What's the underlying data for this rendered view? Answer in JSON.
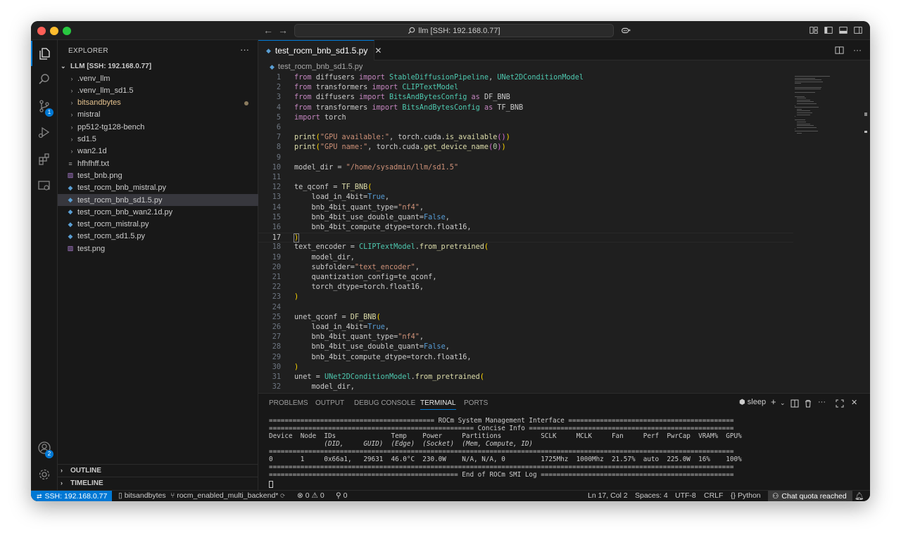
{
  "titlebar": {
    "search_text": "llm [SSH: 192.168.0.77]",
    "back": "←",
    "forward": "→"
  },
  "activitybar": {
    "source_control_badge": "1",
    "accounts_badge": "2"
  },
  "sidebar": {
    "title": "EXPLORER",
    "more": "···",
    "root": "LLM [SSH: 192.168.0.77]",
    "items": [
      {
        "label": ".venv_llm",
        "type": "folder"
      },
      {
        "label": ".venv_llm_sd1.5",
        "type": "folder"
      },
      {
        "label": "bitsandbytes",
        "type": "folder"
      },
      {
        "label": "mistral",
        "type": "folder"
      },
      {
        "label": "pp512-tg128-bench",
        "type": "folder"
      },
      {
        "label": "sd1.5",
        "type": "folder"
      },
      {
        "label": "wan2.1d",
        "type": "folder"
      },
      {
        "label": "hfhfhff.txt",
        "type": "txt"
      },
      {
        "label": "test_bnb.png",
        "type": "img"
      },
      {
        "label": "test_rocm_bnb_mistral.py",
        "type": "py"
      },
      {
        "label": "test_rocm_bnb_sd1.5.py",
        "type": "py"
      },
      {
        "label": "test_rocm_bnb_wan2.1d.py",
        "type": "py"
      },
      {
        "label": "test_rocm_mistral.py",
        "type": "py"
      },
      {
        "label": "test_rocm_sd1.5.py",
        "type": "py"
      },
      {
        "label": "test.png",
        "type": "img"
      }
    ],
    "outline": "OUTLINE",
    "timeline": "TIMELINE"
  },
  "editor": {
    "tab_label": "test_rocm_bnb_sd1.5.py",
    "tab_close": "✕",
    "breadcrumb": "test_rocm_bnb_sd1.5.py",
    "current_line": 17,
    "lines": [
      "from diffusers import StableDiffusionPipeline, UNet2DConditionModel",
      "from transformers import CLIPTextModel",
      "from diffusers import BitsAndBytesConfig as DF_BNB",
      "from transformers import BitsAndBytesConfig as TF_BNB",
      "import torch",
      "",
      "print(\"GPU available:\", torch.cuda.is_available())",
      "print(\"GPU name:\", torch.cuda.get_device_name(0))",
      "",
      "model_dir = \"/home/sysadmin/llm/sd1.5\"",
      "",
      "te_qconf = TF_BNB(",
      "    load_in_4bit=True,",
      "    bnb_4bit_quant_type=\"nf4\",",
      "    bnb_4bit_use_double_quant=False,",
      "    bnb_4bit_compute_dtype=torch.float16,",
      ")",
      "text_encoder = CLIPTextModel.from_pretrained(",
      "    model_dir,",
      "    subfolder=\"text_encoder\",",
      "    quantization_config=te_qconf,",
      "    torch_dtype=torch.float16,",
      ")",
      "",
      "unet_qconf = DF_BNB(",
      "    load_in_4bit=True,",
      "    bnb_4bit_quant_type=\"nf4\",",
      "    bnb_4bit_use_double_quant=False,",
      "    bnb_4bit_compute_dtype=torch.float16,",
      ")",
      "unet = UNet2DConditionModel.from_pretrained(",
      "    model_dir,"
    ]
  },
  "panel": {
    "tabs": [
      "PROBLEMS",
      "OUTPUT",
      "DEBUG CONSOLE",
      "TERMINAL",
      "PORTS"
    ],
    "active_tab": "TERMINAL",
    "terminal_name": "sleep",
    "terminal_lines": [
      "========================================== ROCm System Management Interface ==========================================",
      "==================================================== Concise Info ====================================================",
      "Device  Node  IDs              Temp    Power     Partitions          SCLK     MCLK     Fan     Perf  PwrCap  VRAM%  GPU%",
      "              (DID,     GUID)  (Edge)  (Socket)  (Mem, Compute, ID)",
      "======================================================================================================================",
      "0       1     0x66a1,   29631  46.0°C  230.0W    N/A, N/A, 0         1725Mhz  1000Mhz  21.57%  auto  225.0W  16%    100%",
      "======================================================================================================================",
      "================================================ End of ROCm SMI Log ================================================="
    ]
  },
  "statusbar": {
    "remote": "SSH: 192.168.0.77",
    "repo": "bitsandbytes",
    "branch": "rocm_enabled_multi_backend*",
    "errors": "0",
    "warnings": "0",
    "ports": "0",
    "position": "Ln 17, Col 2",
    "spaces": "Spaces: 4",
    "encoding": "UTF-8",
    "eol": "CRLF",
    "language": "Python",
    "chat": "Chat quota reached"
  },
  "colors": {
    "accent": "#0078d4",
    "editor_bg": "#1f1f1f",
    "sidebar_bg": "#181818"
  }
}
